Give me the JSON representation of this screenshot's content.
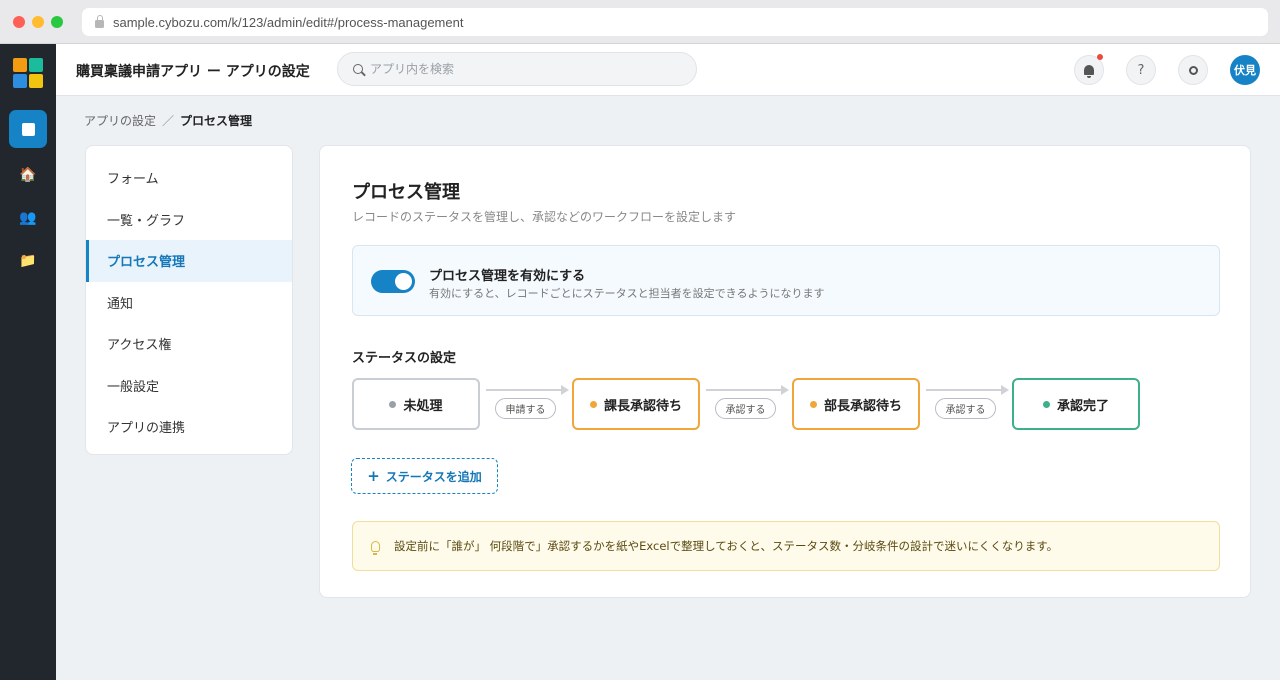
{
  "browser": {
    "url": "sample.cybozu.com/k/123/admin/edit#/process-management"
  },
  "header": {
    "app_title": "購買稟議申請アプリ ー アプリの設定",
    "search_placeholder": "アプリ内を検索",
    "help_label": "?",
    "avatar_label": "伏見"
  },
  "breadcrumb": {
    "parent": "アプリの設定",
    "separator": "／",
    "current": "プロセス管理"
  },
  "sidebar": {
    "items": [
      {
        "label": "フォーム"
      },
      {
        "label": "一覧・グラフ"
      },
      {
        "label": "プロセス管理"
      },
      {
        "label": "通知"
      },
      {
        "label": "アクセス権"
      },
      {
        "label": "一般設定"
      },
      {
        "label": "アプリの連携"
      }
    ],
    "active_index": 2
  },
  "main": {
    "title": "プロセス管理",
    "subtitle": "レコードのステータスを管理し、承認などのワークフローを設定します",
    "enable": {
      "enabled": true,
      "title": "プロセス管理を有効にする",
      "description": "有効にすると、レコードごとにステータスと担当者を設定できるようになります"
    },
    "status_section_title": "ステータスの設定",
    "statuses": [
      {
        "label": "未処理",
        "color": "#9aa0a8"
      },
      {
        "label": "課長承認待ち",
        "color": "#f0a63a"
      },
      {
        "label": "部長承認待ち",
        "color": "#f0a63a"
      },
      {
        "label": "承認完了",
        "color": "#3cb086"
      }
    ],
    "actions": [
      {
        "label": "申請する"
      },
      {
        "label": "承認する"
      },
      {
        "label": "承認する"
      }
    ],
    "add_status_label": "ステータスを追加",
    "tip": "設定前に「誰が」 何段階で」承認するかを紙やExcelで整理しておくと、ステータス数・分岐条件の設計で迷いにくくなります。"
  },
  "colors": {
    "accent": "#1583c6",
    "rail_bg": "#22272d",
    "logo": [
      "#f39c12",
      "#1abc9c",
      "#2d8ee0",
      "#f1c40f"
    ]
  }
}
